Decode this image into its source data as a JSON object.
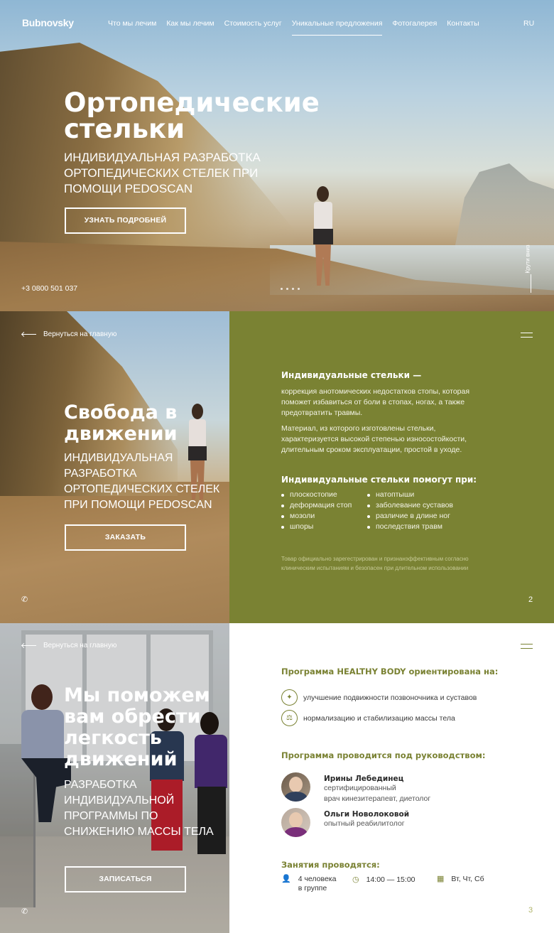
{
  "colors": {
    "olive": "#7a8233",
    "white": "#ffffff"
  },
  "nav": {
    "logo": "Bubnovsky",
    "items": [
      "Что мы лечим",
      "Как мы лечим",
      "Стоимость услуг",
      "Уникальные предложения",
      "Фотогалерея",
      "Контакты"
    ],
    "active_index": 3,
    "lang": "RU"
  },
  "hero": {
    "title": "Ортопедические стельки",
    "subtitle": "Индивидуальная разработка ортопедических стелек при помощи PEDOSCAN",
    "button": "УЗНАТЬ ПОДРОБНЕЙ",
    "phone": "+3 0800 501 037",
    "slides_count": 4,
    "scroll_label": "Крути вниз"
  },
  "section2": {
    "back_link": "Вернуться на главную",
    "title": "Свобода в движении",
    "subtitle": "Индивидуальная разработка ортопедических стелек при помощи PEDOSCAN",
    "button": "ЗАКАЗАТЬ",
    "heading1": "Индивидуальные стельки —",
    "para1": "коррекция анотомических недостатков стопы, которая поможет избавиться от боли в стопах, ногах, а также предотвратить травмы.",
    "para2": "Материал, из которого изготовлены стельки, характеризуется высокой степенью износостойкости, длительным сроком эксплуатации, простой в уходе.",
    "heading2": "Индивидуальные стельки помогут при:",
    "list_left": [
      "плоскостопие",
      "деформация стоп",
      "мозоли",
      "шпоры"
    ],
    "list_right": [
      "натоптыши",
      "заболевание суставов",
      "различие в длине ног",
      "последствия травм"
    ],
    "note": "Товар официально зарегестрирован и признанэффективным согласно клиническим испытаниям и безопасен при длительном использовании",
    "page": "2"
  },
  "section3": {
    "back_link": "Вернуться на главную",
    "title": "Мы поможем вам обрести легкость движений",
    "subtitle": "Разработка индивидуальной программы по снижению массы тела",
    "button": "ЗАПИСАТЬСЯ",
    "heading1": "Программа HEALTHY BODY ориентирована на:",
    "features": [
      {
        "icon": "spine-icon",
        "text": "улучшение подвижности позвоночника и суставов"
      },
      {
        "icon": "scale-icon",
        "text": "нормализацию и стабилизацию массы тела"
      }
    ],
    "heading2": "Программа проводится под руководством:",
    "experts": [
      {
        "name": "Ирины Лебединец",
        "role_line1": "сертифицированный",
        "role_line2": "врач кинезитерапевт, диетолог"
      },
      {
        "name": "Ольги Новолоковой",
        "role_line1": "опытный реабилитолог",
        "role_line2": ""
      }
    ],
    "heading3": "Занятия проводятся:",
    "group_line1": "4 человека",
    "group_line2": "в группе",
    "time": "14:00 — 15:00",
    "days": "Вт, Чт, Сб",
    "page": "3"
  }
}
